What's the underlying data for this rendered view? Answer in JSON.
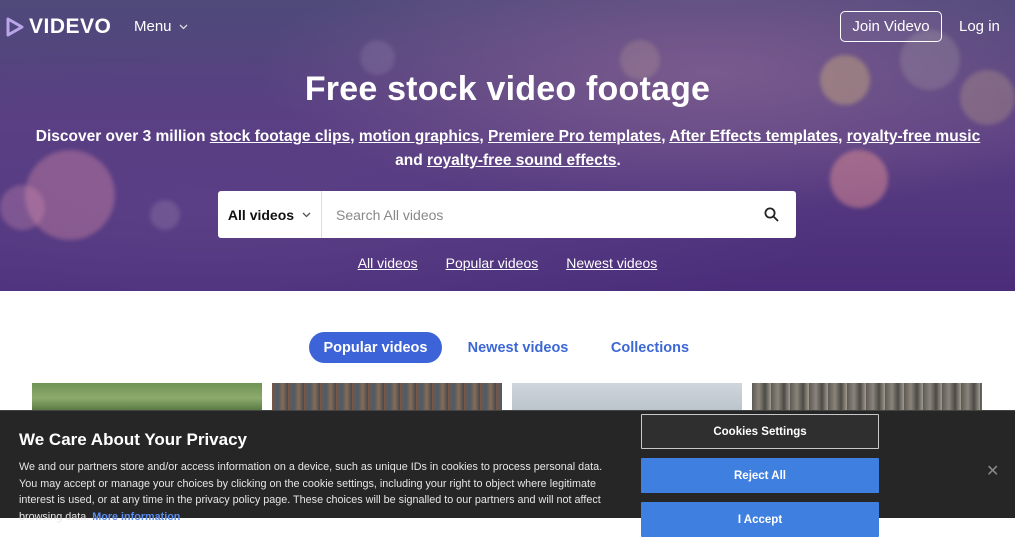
{
  "brand": {
    "name": "VIDEVO"
  },
  "nav": {
    "menu_label": "Menu",
    "join_label": "Join Videvo",
    "login_label": "Log in"
  },
  "hero": {
    "title": "Free stock video footage",
    "sub_intro": "Discover over 3 million ",
    "links": [
      "stock footage clips",
      "motion graphics",
      "Premiere Pro templates",
      "After Effects templates",
      "royalty-free music",
      "royalty-free sound effects"
    ],
    "sep": ", ",
    "and": "and ",
    "period": "."
  },
  "search": {
    "scope_label": "All videos",
    "placeholder": "Search All videos"
  },
  "quick_links": [
    "All videos",
    "Popular videos",
    "Newest videos"
  ],
  "tabs": [
    {
      "label": "Popular videos",
      "active": true
    },
    {
      "label": "Newest videos",
      "active": false
    },
    {
      "label": "Collections",
      "active": false
    }
  ],
  "cookie": {
    "title": "We Care About Your Privacy",
    "text": "We and our partners store and/or access information on a device, such as unique IDs in cookies to process personal data. You may accept or manage your choices by clicking on the cookie settings, including your right to object where legitimate interest is used, or at any time in the privacy policy page. These choices will be signalled to our partners and will not affect browsing data.",
    "more_info": "More information",
    "settings_label": "Cookies Settings",
    "reject_label": "Reject All",
    "accept_label": "I Accept",
    "close_symbol": "✕"
  },
  "icons": {
    "logo": "play-logo-icon",
    "chevron": "chevron-down-icon",
    "search": "search-icon",
    "close": "close-icon"
  },
  "colors": {
    "accent": "#3d63d8",
    "cookie_button": "#3f7fe0",
    "cookie_bg": "#262626"
  }
}
